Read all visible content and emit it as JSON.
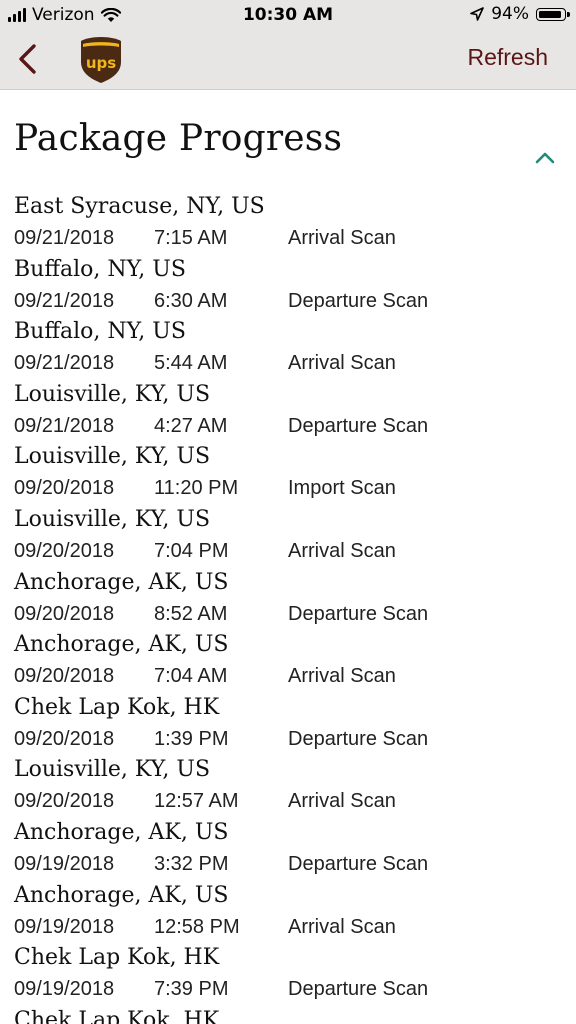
{
  "status_bar": {
    "carrier": "Verizon",
    "time": "10:30 AM",
    "battery": "94%",
    "battery_level": 0.94,
    "icons": [
      "signal-icon",
      "wifi-icon",
      "location-arrow-icon",
      "battery-icon"
    ]
  },
  "nav": {
    "back_icon": "chevron-left-icon",
    "logo_icon": "ups-shield-logo",
    "logo_text": "ups",
    "refresh_label": "Refresh"
  },
  "section": {
    "title": "Package Progress",
    "toggle_icon": "chevron-up-icon"
  },
  "events": [
    {
      "location": "East Syracuse, NY, US",
      "date": "09/21/2018",
      "time": "7:15 AM",
      "activity": "Arrival Scan"
    },
    {
      "location": "Buffalo, NY, US",
      "date": "09/21/2018",
      "time": "6:30 AM",
      "activity": "Departure Scan"
    },
    {
      "location": "Buffalo, NY, US",
      "date": "09/21/2018",
      "time": "5:44 AM",
      "activity": "Arrival Scan"
    },
    {
      "location": "Louisville, KY, US",
      "date": "09/21/2018",
      "time": "4:27 AM",
      "activity": "Departure Scan"
    },
    {
      "location": "Louisville, KY, US",
      "date": "09/20/2018",
      "time": "11:20 PM",
      "activity": "Import Scan"
    },
    {
      "location": "Louisville, KY, US",
      "date": "09/20/2018",
      "time": "7:04 PM",
      "activity": "Arrival Scan"
    },
    {
      "location": "Anchorage, AK, US",
      "date": "09/20/2018",
      "time": "8:52 AM",
      "activity": "Departure Scan"
    },
    {
      "location": "Anchorage, AK, US",
      "date": "09/20/2018",
      "time": "7:04 AM",
      "activity": "Arrival Scan"
    },
    {
      "location": "Chek Lap Kok, HK",
      "date": "09/20/2018",
      "time": "1:39 PM",
      "activity": "Departure Scan"
    },
    {
      "location": "Louisville, KY, US",
      "date": "09/20/2018",
      "time": "12:57 AM",
      "activity": "Arrival Scan"
    },
    {
      "location": "Anchorage, AK, US",
      "date": "09/19/2018",
      "time": "3:32 PM",
      "activity": "Departure Scan"
    },
    {
      "location": "Anchorage, AK, US",
      "date": "09/19/2018",
      "time": "12:58 PM",
      "activity": "Arrival Scan"
    },
    {
      "location": "Chek Lap Kok, HK",
      "date": "09/19/2018",
      "time": "7:39 PM",
      "activity": "Departure Scan"
    },
    {
      "location": "Chek Lap Kok, HK",
      "date": "",
      "time": "",
      "activity": ""
    }
  ],
  "colors": {
    "header_bg": "#e8e6e4",
    "brand_brown": "#5a1616",
    "ups_gold": "#f2b51c",
    "ups_brown": "#4a2a12",
    "accent_teal": "#1f8a7a"
  }
}
